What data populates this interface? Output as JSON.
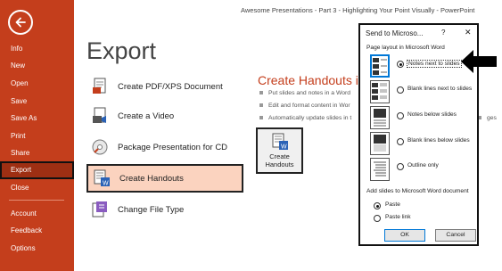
{
  "window_title": "Awesome Presentations - Part 3 - Highlighting Your Point Visually  -  PowerPoint",
  "sidebar": {
    "items": [
      {
        "label": "Info"
      },
      {
        "label": "New"
      },
      {
        "label": "Open"
      },
      {
        "label": "Save"
      },
      {
        "label": "Save As"
      },
      {
        "label": "Print"
      },
      {
        "label": "Share"
      },
      {
        "label": "Export"
      },
      {
        "label": "Close"
      },
      {
        "label": "Account"
      },
      {
        "label": "Feedback"
      },
      {
        "label": "Options"
      }
    ],
    "active": "Export"
  },
  "page_title": "Export",
  "export_options": [
    {
      "label": "Create PDF/XPS Document",
      "icon": "pdf-document-icon"
    },
    {
      "label": "Create a Video",
      "icon": "video-icon"
    },
    {
      "label": "Package Presentation for CD",
      "icon": "cd-icon"
    },
    {
      "label": "Create Handouts",
      "icon": "handouts-icon"
    },
    {
      "label": "Change File Type",
      "icon": "file-type-icon"
    }
  ],
  "handouts_panel": {
    "title": "Create Handouts in M",
    "bullets": [
      "Put slides and notes in a Word",
      "Edit and format content in Wor",
      "Automatically update slides in t"
    ],
    "bullet_overflow": "ges",
    "button_label_line1": "Create",
    "button_label_line2": "Handouts"
  },
  "dialog": {
    "title": "Send to Microso...",
    "help": "?",
    "close": "✕",
    "layout_heading": "Page layout in Microsoft Word",
    "layout_options": [
      {
        "label": "Notes next to slides",
        "selected": true
      },
      {
        "label": "Blank lines next to slides",
        "selected": false
      },
      {
        "label": "Notes below slides",
        "selected": false
      },
      {
        "label": "Blank lines below slides",
        "selected": false
      },
      {
        "label": "Outline only",
        "selected": false
      }
    ],
    "add_heading": "Add slides to Microsoft Word document",
    "add_options": [
      {
        "label": "Paste",
        "selected": true
      },
      {
        "label": "Paste link",
        "selected": false
      }
    ],
    "ok_label": "OK",
    "cancel_label": "Cancel"
  },
  "colors": {
    "sidebar": "#c43e1c",
    "accent_text": "#c43e1c",
    "selected_option_bg": "#fbd3bf",
    "focus_blue": "#0078d7"
  }
}
